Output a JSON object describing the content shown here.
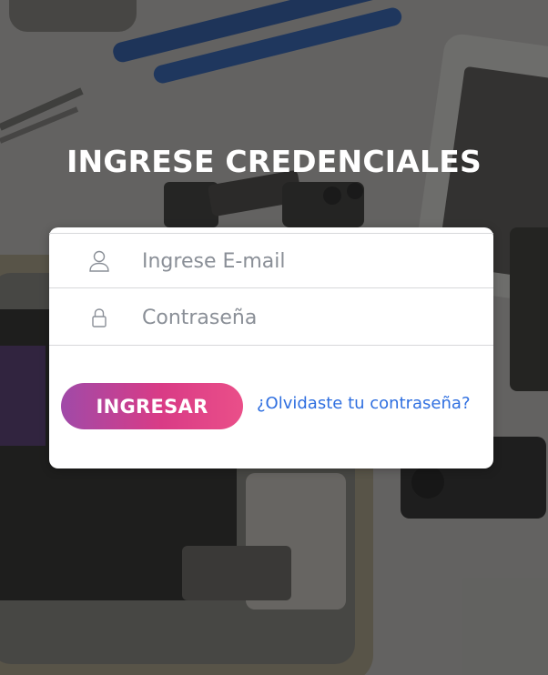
{
  "heading": "INGRESE CREDENCIALES",
  "email_field": {
    "placeholder": "Ingrese E-mail",
    "value": "",
    "icon": "user-icon"
  },
  "password_field": {
    "placeholder": "Contraseña",
    "value": "",
    "icon": "lock-icon"
  },
  "submit_button": {
    "label": "INGRESAR"
  },
  "forgot_link": {
    "label": "¿Olvidaste tu contraseña?"
  },
  "colors": {
    "button_gradient_start": "#a04aa8",
    "button_gradient_end": "#ea4f89",
    "link": "#2f6fe0",
    "card_background": "#ffffff",
    "heading_text": "#ffffff"
  }
}
